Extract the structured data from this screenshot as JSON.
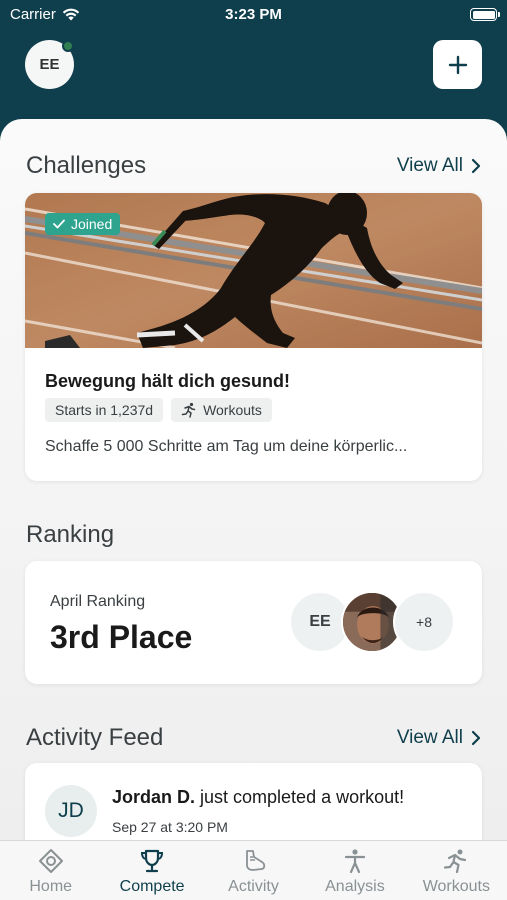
{
  "status_bar": {
    "carrier": "Carrier",
    "time": "3:23 PM"
  },
  "header": {
    "user_initials": "EE"
  },
  "challenges": {
    "title": "Challenges",
    "view_all": "View All",
    "card": {
      "badge": "Joined",
      "name": "Bewegung hält dich gesund!",
      "starts": "Starts in 1,237d",
      "category": "Workouts",
      "description": "Schaffe 5 000 Schritte am Tag um deine körperlic..."
    }
  },
  "ranking": {
    "title": "Ranking",
    "label": "April Ranking",
    "place": "3rd Place",
    "avatars": {
      "first": "EE",
      "more": "+8"
    }
  },
  "activity_feed": {
    "title": "Activity Feed",
    "view_all": "View All",
    "item": {
      "initials": "JD",
      "name": "Jordan D.",
      "action": " just completed a workout!",
      "time": "Sep 27 at 3:20 PM"
    }
  },
  "tabs": [
    {
      "label": "Home",
      "icon": "home-icon"
    },
    {
      "label": "Compete",
      "icon": "trophy-icon",
      "active": true
    },
    {
      "label": "Activity",
      "icon": "shoe-icon"
    },
    {
      "label": "Analysis",
      "icon": "person-icon"
    },
    {
      "label": "Workouts",
      "icon": "runner-icon"
    }
  ],
  "colors": {
    "brand": "#0f3f4c",
    "joined_badge": "#2ea48e",
    "online_dot": "#2f7d51"
  }
}
